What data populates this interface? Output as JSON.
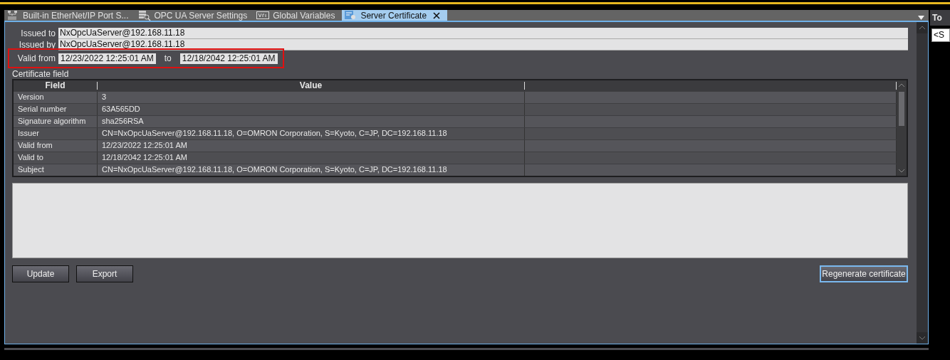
{
  "tabs": [
    {
      "label": "Built-in EtherNet/IP Port S...",
      "kind": "eip",
      "selected": false
    },
    {
      "label": "OPC UA Server Settings",
      "kind": "server",
      "selected": false
    },
    {
      "label": "Global Variables",
      "kind": "var",
      "selected": false
    },
    {
      "label": "Server Certificate",
      "kind": "cert",
      "selected": true
    }
  ],
  "certificate": {
    "issued_to_label": "Issued to",
    "issued_to": "NxOpcUaServer@192.168.11.18",
    "issued_by_label": "Issued by",
    "issued_by": "NxOpcUaServer@192.168.11.18",
    "valid_from_label": "Valid from",
    "valid_from": "12/23/2022 12:25:01 AM",
    "to_label": "to",
    "valid_to": "12/18/2042 12:25:01 AM",
    "validity_highlighted": true
  },
  "table": {
    "caption": "Certificate field",
    "columns": [
      "Field",
      "Value"
    ],
    "rows": [
      {
        "field": "Version",
        "value": "3"
      },
      {
        "field": "Serial number",
        "value": "63A565DD"
      },
      {
        "field": "Signature algorithm",
        "value": "sha256RSA"
      },
      {
        "field": "Issuer",
        "value": "CN=NxOpcUaServer@192.168.11.18, O=OMRON Corporation, S=Kyoto, C=JP, DC=192.168.11.18"
      },
      {
        "field": "Valid from",
        "value": "12/23/2022 12:25:01 AM"
      },
      {
        "field": "Valid to",
        "value": "12/18/2042 12:25:01 AM"
      },
      {
        "field": "Subject",
        "value": "CN=NxOpcUaServer@192.168.11.18, O=OMRON Corporation, S=Kyoto, C=JP, DC=192.168.11.18"
      }
    ]
  },
  "buttons": [
    {
      "label": "Update",
      "focused": false
    },
    {
      "label": "Export",
      "focused": false
    }
  ],
  "regenerate_button": {
    "label": "Regenerate certificate",
    "focused": true
  },
  "side_panel": {
    "title": "To",
    "field_value": "<S"
  }
}
